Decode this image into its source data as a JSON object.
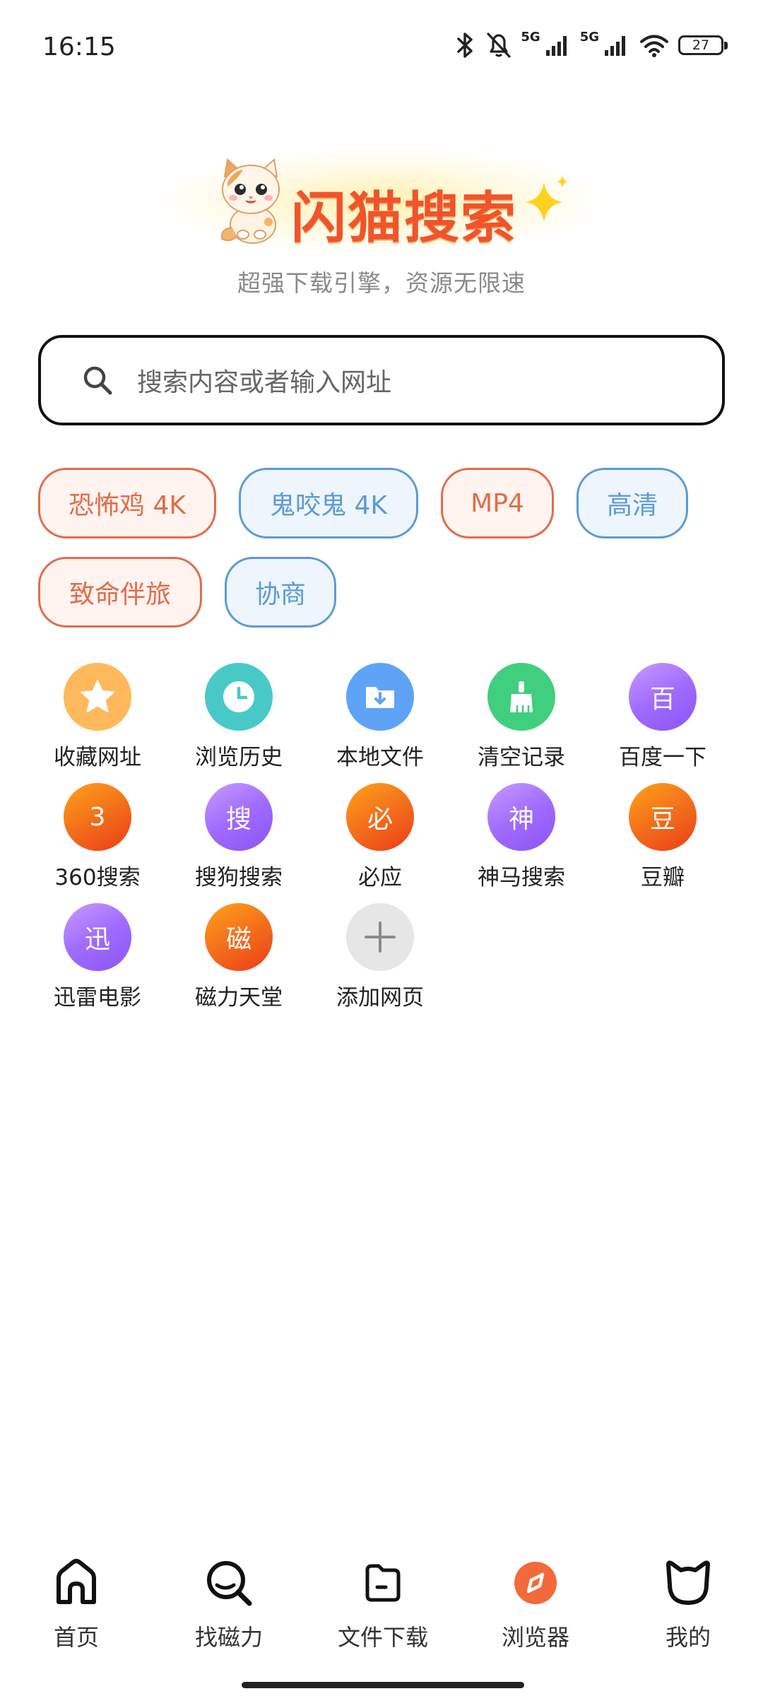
{
  "status_bar": {
    "time": "16:15",
    "network_1": "5G",
    "network_2": "5G",
    "battery": "27"
  },
  "logo": {
    "title": "闪猫搜索",
    "slogan": "超强下载引擎，资源无限速"
  },
  "search": {
    "placeholder": "搜索内容或者输入网址"
  },
  "tags": [
    {
      "label": "恐怖鸡 4K",
      "style": "orange"
    },
    {
      "label": "鬼咬鬼 4K",
      "style": "blue"
    },
    {
      "label": "MP4",
      "style": "orange"
    },
    {
      "label": "高清",
      "style": "blue"
    },
    {
      "label": "致命伴旅",
      "style": "orange"
    },
    {
      "label": "协商",
      "style": "blue"
    }
  ],
  "shortcuts": [
    {
      "label": "收藏网址",
      "icon": "star-icon",
      "color": "#ffb85c"
    },
    {
      "label": "浏览历史",
      "icon": "clock-icon",
      "color": "#48c9c7"
    },
    {
      "label": "本地文件",
      "icon": "folder-download-icon",
      "color": "#5ea3f6"
    },
    {
      "label": "清空记录",
      "icon": "broom-icon",
      "color": "#3fcf7f"
    },
    {
      "label": "百度一下",
      "glyph": "百",
      "color": "#a66cff"
    },
    {
      "label": "360搜索",
      "glyph": "3",
      "color": "#f26a1b"
    },
    {
      "label": "搜狗搜索",
      "glyph": "搜",
      "color": "#a66cff"
    },
    {
      "label": "必应",
      "glyph": "必",
      "color": "#f26a1b"
    },
    {
      "label": "神马搜索",
      "glyph": "神",
      "color": "#a66cff"
    },
    {
      "label": "豆瓣",
      "glyph": "豆",
      "color": "#f26a1b"
    },
    {
      "label": "迅雷电影",
      "glyph": "迅",
      "color": "#a66cff"
    },
    {
      "label": "磁力天堂",
      "glyph": "磁",
      "color": "#f26a1b"
    },
    {
      "label": "添加网页",
      "icon": "plus-icon",
      "color": "#e6e6e6"
    }
  ],
  "nav": {
    "home": "首页",
    "magnet": "找磁力",
    "downloads": "文件下载",
    "browser": "浏览器",
    "mine": "我的"
  },
  "colors": {
    "brand": "#f0542a",
    "tag_orange": "#e36b4b",
    "tag_blue": "#5b9bd5",
    "nav_accent": "#f26a3a"
  }
}
